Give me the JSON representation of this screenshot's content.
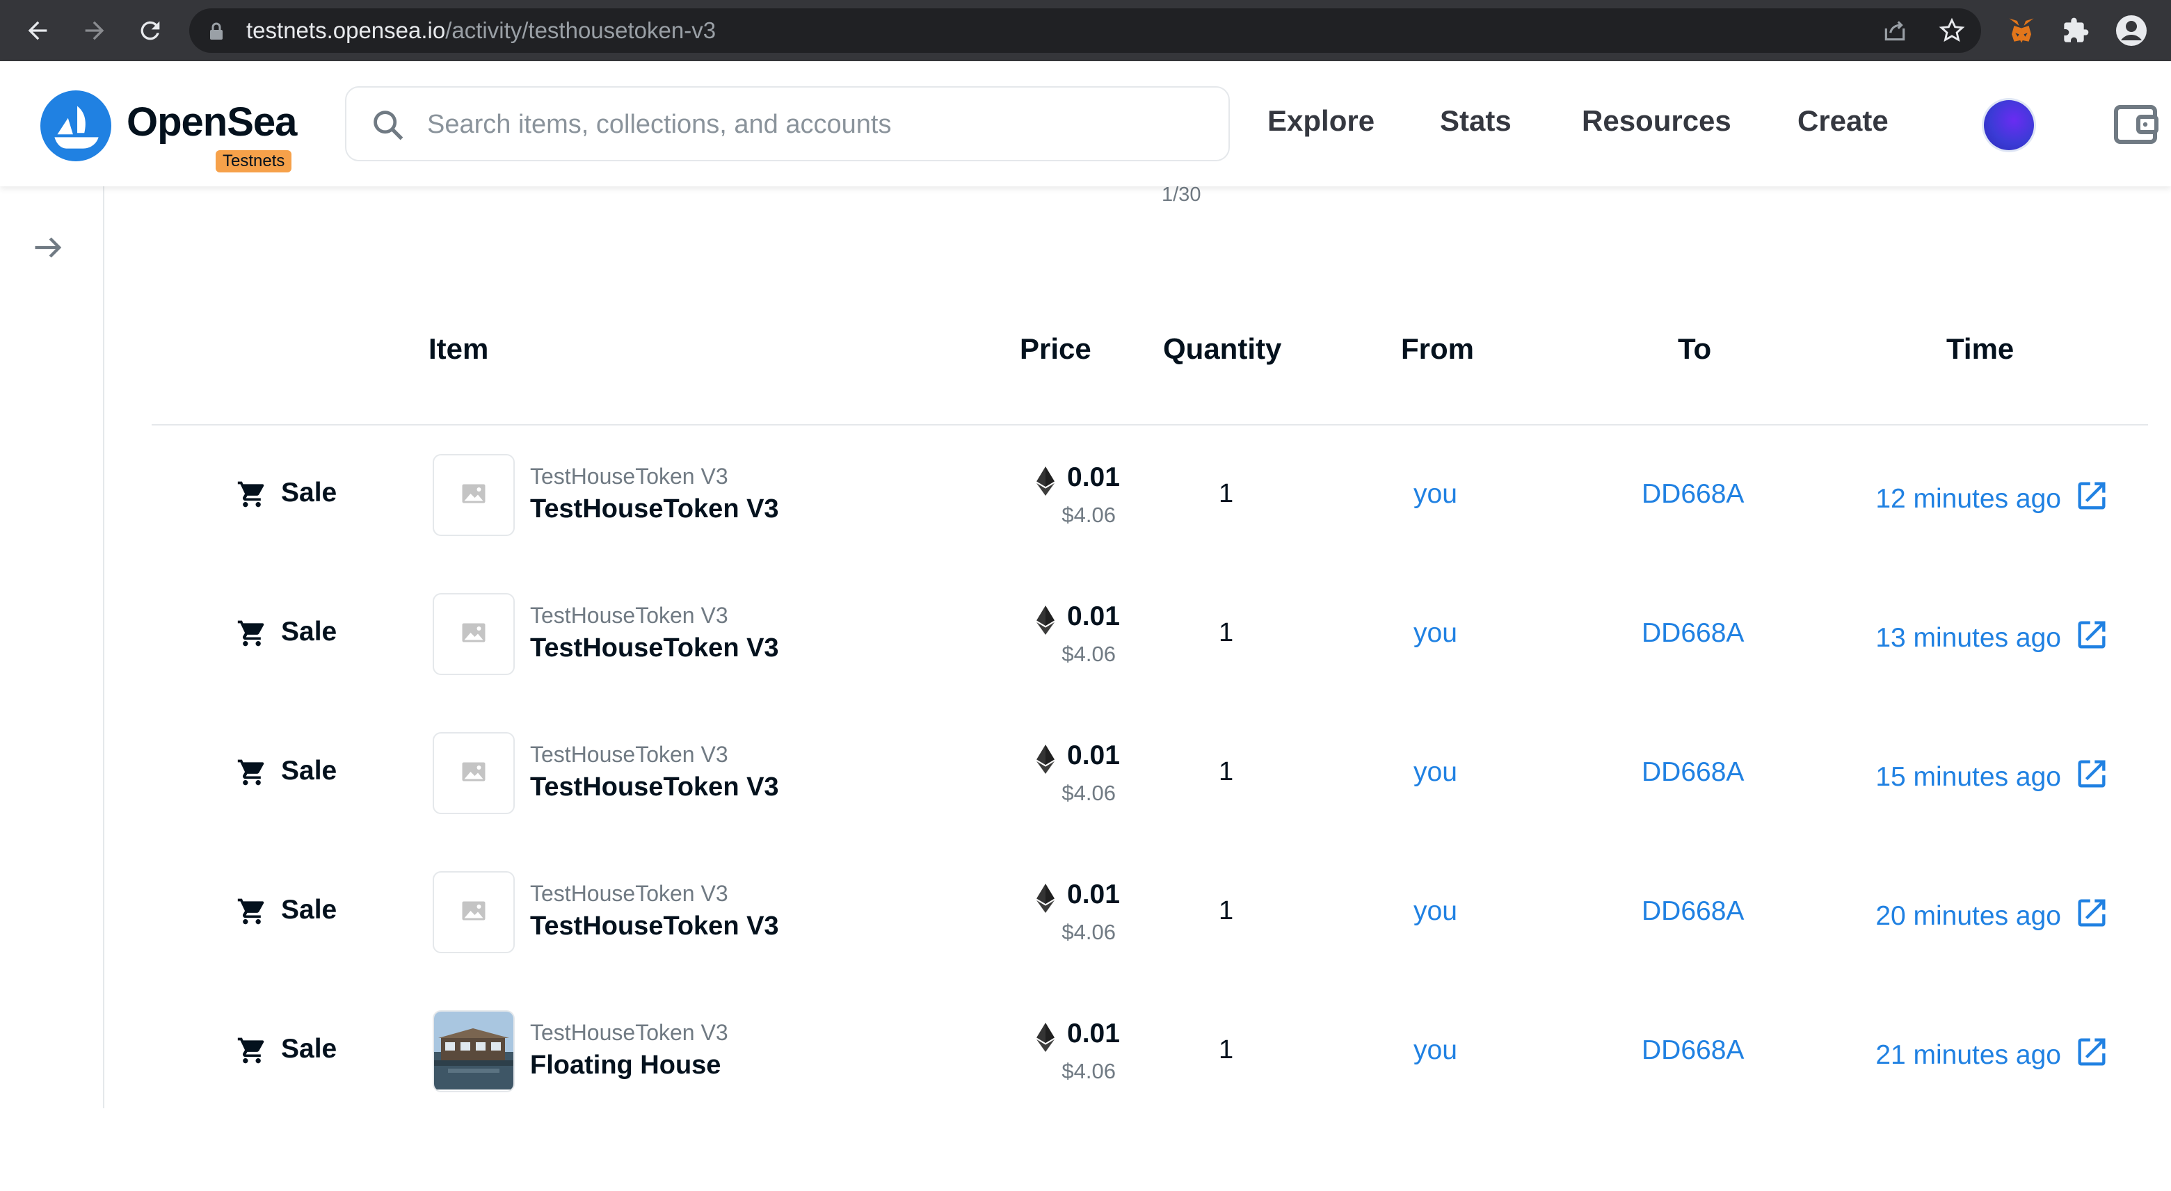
{
  "browser": {
    "url_host": "testnets.opensea.io",
    "url_path": "/activity/testhousetoken-v3"
  },
  "header": {
    "brand": "OpenSea",
    "badge": "Testnets",
    "search_placeholder": "Search items, collections, and accounts",
    "nav": [
      "Explore",
      "Stats",
      "Resources",
      "Create"
    ]
  },
  "pagination": "1/30",
  "table": {
    "columns": [
      "Item",
      "Price",
      "Quantity",
      "From",
      "To",
      "Time"
    ],
    "rows": [
      {
        "event": "Sale",
        "collection": "TestHouseToken V3",
        "item": "TestHouseToken V3",
        "price": "0.01",
        "usd": "$4.06",
        "quantity": "1",
        "from": "you",
        "to": "DD668A",
        "time": "12 minutes ago",
        "thumb": "placeholder"
      },
      {
        "event": "Sale",
        "collection": "TestHouseToken V3",
        "item": "TestHouseToken V3",
        "price": "0.01",
        "usd": "$4.06",
        "quantity": "1",
        "from": "you",
        "to": "DD668A",
        "time": "13 minutes ago",
        "thumb": "placeholder"
      },
      {
        "event": "Sale",
        "collection": "TestHouseToken V3",
        "item": "TestHouseToken V3",
        "price": "0.01",
        "usd": "$4.06",
        "quantity": "1",
        "from": "you",
        "to": "DD668A",
        "time": "15 minutes ago",
        "thumb": "placeholder"
      },
      {
        "event": "Sale",
        "collection": "TestHouseToken V3",
        "item": "TestHouseToken V3",
        "price": "0.01",
        "usd": "$4.06",
        "quantity": "1",
        "from": "you",
        "to": "DD668A",
        "time": "20 minutes ago",
        "thumb": "placeholder"
      },
      {
        "event": "Sale",
        "collection": "TestHouseToken V3",
        "item": "Floating House",
        "price": "0.01",
        "usd": "$4.06",
        "quantity": "1",
        "from": "you",
        "to": "DD668A",
        "time": "21 minutes ago",
        "thumb": "photo"
      }
    ]
  },
  "colors": {
    "link": "#2081e2",
    "brand": "#2081e2",
    "badge": "#f6a14a"
  }
}
